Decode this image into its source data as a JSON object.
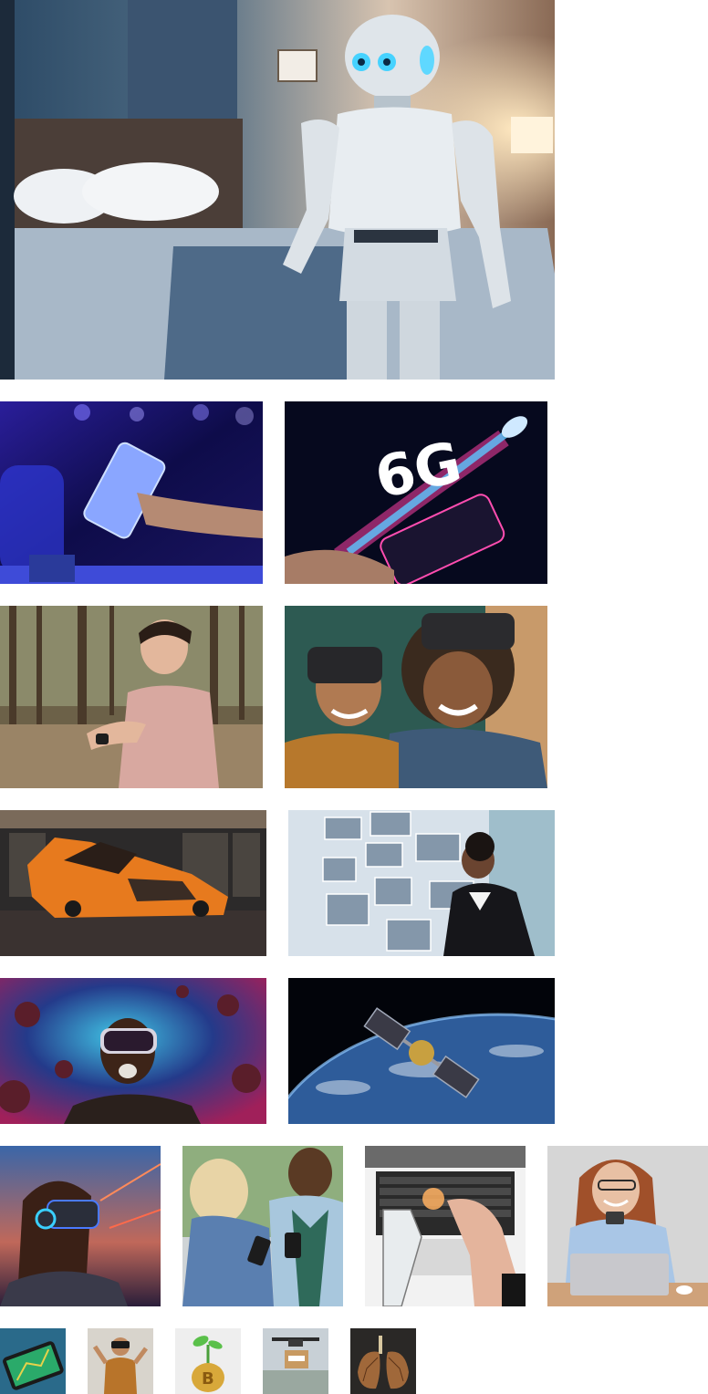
{
  "gallery": {
    "rows": [
      {
        "name": "hero-row",
        "images": [
          {
            "subject": "humanoid-robot-in-hotel-bedroom"
          }
        ]
      },
      {
        "name": "row-2",
        "images": [
          {
            "subject": "hand-holding-glowing-smartphone"
          },
          {
            "subject": "6g-rocket-from-smartphone"
          }
        ]
      },
      {
        "name": "row-3",
        "images": [
          {
            "subject": "woman-checking-smartwatch-in-forest"
          },
          {
            "subject": "kids-laughing-with-vr-headsets"
          }
        ]
      },
      {
        "name": "row-4",
        "images": [
          {
            "subject": "orange-futuristic-hover-car"
          },
          {
            "subject": "woman-with-floating-video-screens"
          }
        ]
      },
      {
        "name": "row-5",
        "images": [
          {
            "subject": "man-with-vr-headset-in-space"
          },
          {
            "subject": "satellite-orbiting-earth"
          }
        ]
      },
      {
        "name": "row-6",
        "images": [
          {
            "subject": "woman-with-vr-headset-sunset"
          },
          {
            "subject": "people-looking-at-phones"
          },
          {
            "subject": "robot-hand-and-human-hand-on-laptop"
          },
          {
            "subject": "woman-smiling-at-phone-at-desk"
          }
        ]
      },
      {
        "name": "row-7",
        "images": [
          {
            "subject": "smartphone-with-3d-map"
          },
          {
            "subject": "man-with-vr-headset-raising-hands"
          },
          {
            "subject": "plant-sprouting-from-bitcoin"
          },
          {
            "subject": "delivery-drone-carrying-box"
          },
          {
            "subject": "illustrated-lungs"
          }
        ]
      }
    ],
    "colors": {
      "background": "#ffffff"
    }
  }
}
